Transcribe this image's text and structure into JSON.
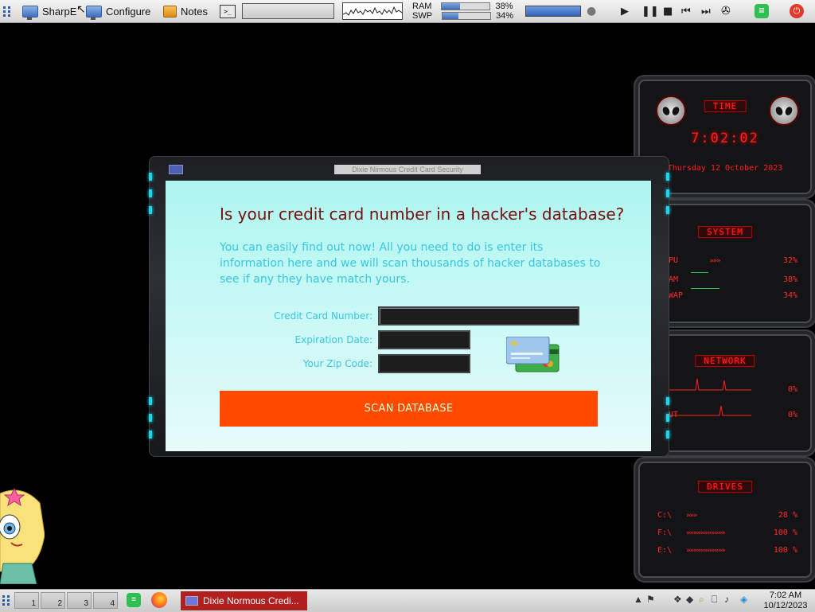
{
  "top_panel": {
    "launcher1": "SharpE",
    "launcher2": "Configure",
    "launcher3": "Notes",
    "ram_label": "RAM",
    "ram_value": "38%",
    "ram_fraction": 0.38,
    "swp_label": "SWP",
    "swp_value": "34%",
    "swp_fraction": 0.34
  },
  "window": {
    "title": "Dixie Nirmous Credit Card Security",
    "headline": "Is your credit card number in a hacker's database?",
    "intro": "You can easily find out now! All you need to do is enter its information here and we will scan thousands of hacker databases to see if any they have match yours.",
    "fields": {
      "cc_label": "Credit Card Number:",
      "exp_label": "Expiration Date:",
      "zip_label": "Your Zip Code:"
    },
    "button": "SCAN DATABASE"
  },
  "widgets": {
    "time": {
      "title": "TIME",
      "clock": "7:02:02",
      "date": "Thursday 12 October 2023"
    },
    "system": {
      "title": "SYSTEM",
      "rows": [
        {
          "label": "CPU",
          "value": "32%"
        },
        {
          "label": "RAM",
          "value": "38%"
        },
        {
          "label": "SWAP",
          "value": "34%"
        }
      ]
    },
    "network": {
      "title": "NETWORK",
      "rows": [
        {
          "label": "IN",
          "value": "0%"
        },
        {
          "label": "OUT",
          "value": "0%"
        }
      ]
    },
    "drives": {
      "title": "DRIVES",
      "rows": [
        {
          "label": "C:\\",
          "value": "28 %"
        },
        {
          "label": "F:\\",
          "value": "100 %"
        },
        {
          "label": "E:\\",
          "value": "100 %"
        }
      ]
    }
  },
  "taskbar": {
    "workspaces": [
      "1",
      "2",
      "3",
      "4"
    ],
    "task_label": "Dixie Normous Credi...",
    "clock_time": "7:02 AM",
    "clock_date": "10/12/2023"
  }
}
